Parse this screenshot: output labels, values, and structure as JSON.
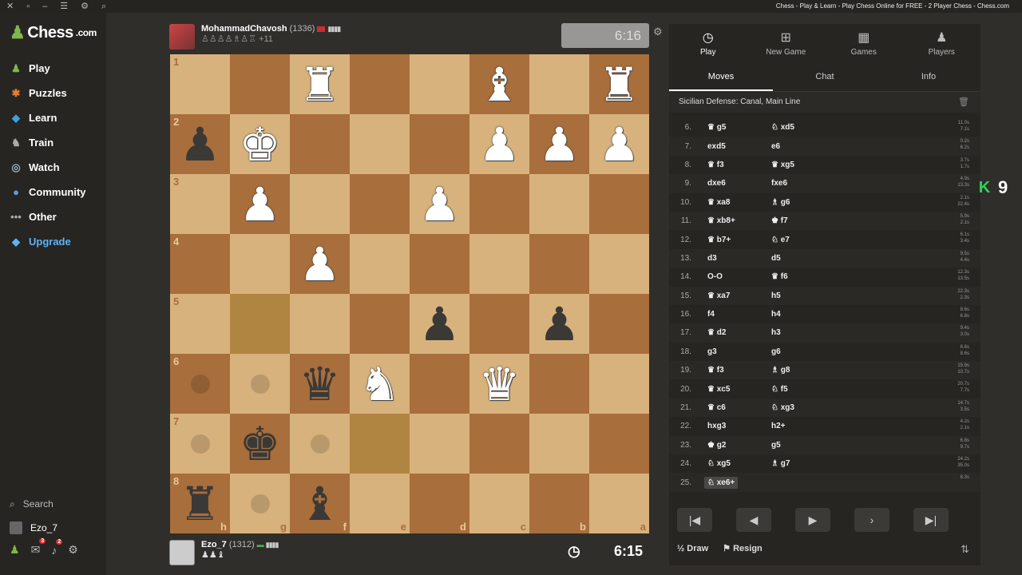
{
  "window": {
    "title": "Chess - Play & Learn - Play Chess Online for FREE - 2 Player Chess - Chess.com"
  },
  "sidebar": {
    "logo": "Chess",
    "logo_suffix": ".com",
    "items": [
      {
        "label": "Play",
        "icon": "play-icon"
      },
      {
        "label": "Puzzles",
        "icon": "puzzle-icon"
      },
      {
        "label": "Learn",
        "icon": "learn-icon"
      },
      {
        "label": "Train",
        "icon": "train-icon"
      },
      {
        "label": "Watch",
        "icon": "watch-icon"
      },
      {
        "label": "Community",
        "icon": "community-icon"
      },
      {
        "label": "Other",
        "icon": "more-icon"
      },
      {
        "label": "Upgrade",
        "icon": "diamond-icon"
      }
    ],
    "search_label": "Search",
    "username": "Ezo_7",
    "mail_badge": "3",
    "notif_badge": "2"
  },
  "top_player": {
    "name": "MohammadChavosh",
    "rating": "(1336)",
    "captured": "♙♙♙♙♗♙♖ +11",
    "clock": "6:16"
  },
  "bottom_player": {
    "name": "Ezo_7",
    "rating": "(1312)",
    "captured": "♟♟♝",
    "clock": "6:15"
  },
  "board": {
    "orientation": "black",
    "ranks": [
      "1",
      "2",
      "3",
      "4",
      "5",
      "6",
      "7",
      "8"
    ],
    "files": [
      "h",
      "g",
      "f",
      "e",
      "d",
      "c",
      "b",
      "a"
    ],
    "position": [
      [
        "",
        "",
        "wR",
        "",
        "",
        "wB",
        "",
        "wR"
      ],
      [
        "bP",
        "wK",
        "",
        "",
        "",
        "wP",
        "wP",
        "wP"
      ],
      [
        "",
        "wP",
        "",
        "",
        "wP",
        "",
        "",
        ""
      ],
      [
        "",
        "",
        "wP",
        "",
        "",
        "",
        "",
        ""
      ],
      [
        "",
        "",
        "",
        "",
        "bP",
        "",
        "bP",
        ""
      ],
      [
        "",
        "",
        "bQ",
        "wN",
        "",
        "wQ",
        "",
        ""
      ],
      [
        "",
        "bK",
        "",
        "",
        "",
        "",
        "",
        ""
      ],
      [
        "bR",
        "",
        "bB",
        "",
        "",
        "",
        "",
        ""
      ]
    ],
    "highlights": [
      "6-3",
      "4-1"
    ],
    "move_dots": [
      "5-0",
      "5-1",
      "6-0",
      "6-2",
      "7-1"
    ]
  },
  "panel": {
    "tabs": [
      {
        "label": "Play",
        "icon": "stopwatch-icon"
      },
      {
        "label": "New Game",
        "icon": "plus-icon"
      },
      {
        "label": "Games",
        "icon": "board-icon"
      },
      {
        "label": "Players",
        "icon": "players-icon"
      }
    ],
    "subtabs": [
      "Moves",
      "Chat",
      "Info"
    ],
    "opening": "Sicilian Defense: Canal, Main Line",
    "moves": [
      {
        "n": "6.",
        "w": "♛ g5",
        "b": "♘ xd5",
        "tw": "11.0s",
        "tb": "7.1s"
      },
      {
        "n": "7.",
        "w": "exd5",
        "b": "e6",
        "tw": "0.2s",
        "tb": "6.2s"
      },
      {
        "n": "8.",
        "w": "♛ f3",
        "b": "♛ xg5",
        "tw": "3.7s",
        "tb": "1.7s"
      },
      {
        "n": "9.",
        "w": "dxe6",
        "b": "fxe6",
        "tw": "4.9s",
        "tb": "13.3s"
      },
      {
        "n": "10.",
        "w": "♛ xa8",
        "b": "♗ g6",
        "tw": "2.1s",
        "tb": "22.4s"
      },
      {
        "n": "11.",
        "w": "♛ xb8+",
        "b": "♚ f7",
        "tw": "5.9s",
        "tb": "2.1s"
      },
      {
        "n": "12.",
        "w": "♛ b7+",
        "b": "♘ e7",
        "tw": "6.1s",
        "tb": "3.4s"
      },
      {
        "n": "13.",
        "w": "d3",
        "b": "d5",
        "tw": "9.5s",
        "tb": "4.4s"
      },
      {
        "n": "14.",
        "w": "O-O",
        "b": "♛ f6",
        "tw": "12.3s",
        "tb": "13.5s"
      },
      {
        "n": "15.",
        "w": "♛ xa7",
        "b": "h5",
        "tw": "22.3s",
        "tb": "2.3s"
      },
      {
        "n": "16.",
        "w": "f4",
        "b": "h4",
        "tw": "8.6s",
        "tb": "6.8s"
      },
      {
        "n": "17.",
        "w": "♛ d2",
        "b": "h3",
        "tw": "9.4s",
        "tb": "3.0s"
      },
      {
        "n": "18.",
        "w": "g3",
        "b": "g6",
        "tw": "6.6s",
        "tb": "8.6s"
      },
      {
        "n": "19.",
        "w": "♛ f3",
        "b": "♗ g8",
        "tw": "15.9s",
        "tb": "10.7s"
      },
      {
        "n": "20.",
        "w": "♛ xc5",
        "b": "♘ f5",
        "tw": "20.7s",
        "tb": "7.7s"
      },
      {
        "n": "21.",
        "w": "♛ c6",
        "b": "♘ xg3",
        "tw": "14.7s",
        "tb": "3.5s"
      },
      {
        "n": "22.",
        "w": "hxg3",
        "b": "h2+",
        "tw": "4.2s",
        "tb": "2.1s"
      },
      {
        "n": "23.",
        "w": "♚ g2",
        "b": "g5",
        "tw": "6.8s",
        "tb": "9.7s"
      },
      {
        "n": "24.",
        "w": "♘ xg5",
        "b": "♗ g7",
        "tw": "24.2s",
        "tb": "35.0s"
      },
      {
        "n": "25.",
        "w": "♘ xe6+",
        "b": "",
        "tw": "8.3s",
        "tb": ""
      }
    ],
    "draw_label": "Draw",
    "resign_label": "Resign",
    "draw_icon": "½"
  },
  "overlay": {
    "letter": "K",
    "number": "9"
  }
}
